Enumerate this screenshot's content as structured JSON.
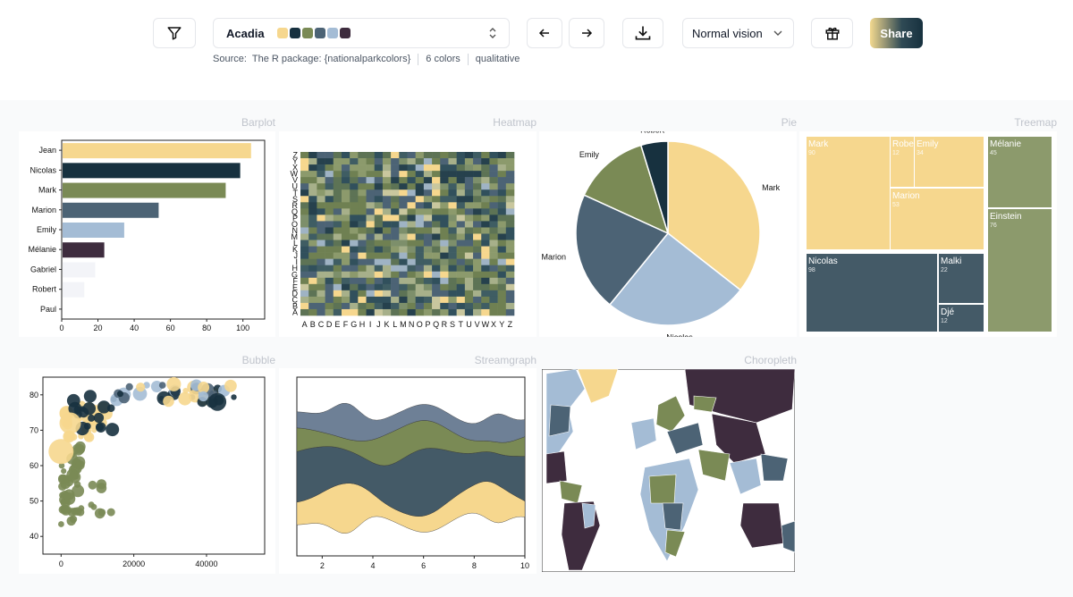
{
  "toolbar": {
    "palette_name": "Acadia",
    "colors": [
      "#f6d78e",
      "#17313f",
      "#7a8a55",
      "#4c6375",
      "#a4bcd5",
      "#3e2c3e"
    ],
    "source_label": "Source:",
    "source_value": "The R package: {nationalparkcolors}",
    "color_count": "6 colors",
    "palette_type": "qualitative",
    "vision_mode": "Normal vision",
    "share_label": "Share"
  },
  "panels": {
    "barplot": "Barplot",
    "heatmap": "Heatmap",
    "pie": "Pie",
    "treemap": "Treemap",
    "bubble": "Bubble",
    "streamgraph": "Streamgraph",
    "choropleth": "Choropleth"
  },
  "chart_data": [
    {
      "type": "bar",
      "title": "Barplot",
      "categories": [
        "Jean",
        "Nicolas",
        "Mark",
        "Marion",
        "Emily",
        "Mélanie",
        "Gabriel",
        "Robert",
        "Paul"
      ],
      "values": [
        104,
        98,
        90,
        53,
        34,
        23,
        18,
        12,
        0
      ],
      "colors": [
        "#f6d78e",
        "#17313f",
        "#7a8a55",
        "#4c6375",
        "#a4bcd5",
        "#3e2c3e",
        "#f3f4f8",
        "#f3f4f8",
        "#f3f4f8"
      ],
      "xticks": [
        0,
        20,
        40,
        60,
        80,
        100
      ],
      "xlim": [
        0,
        112
      ]
    },
    {
      "type": "heatmap",
      "title": "Heatmap",
      "xlabels": [
        "A",
        "B",
        "C",
        "D",
        "E",
        "F",
        "G",
        "H",
        "I",
        "J",
        "K",
        "L",
        "M",
        "N",
        "O",
        "P",
        "Q",
        "R",
        "S",
        "T",
        "U",
        "V",
        "W",
        "X",
        "Y",
        "Z"
      ],
      "ylabels": [
        "Z",
        "Y",
        "X",
        "W",
        "V",
        "U",
        "T",
        "S",
        "R",
        "Q",
        "P",
        "O",
        "N",
        "M",
        "L",
        "K",
        "J",
        "I",
        "H",
        "G",
        "F",
        "E",
        "D",
        "C",
        "B",
        "A"
      ]
    },
    {
      "type": "pie",
      "title": "Pie",
      "slices": [
        {
          "label": "Mark",
          "value": 90,
          "color": "#f6d78e"
        },
        {
          "label": "Nicolas",
          "value": 64,
          "color": "#a4bcd5"
        },
        {
          "label": "Marion",
          "value": 53,
          "color": "#4c6375"
        },
        {
          "label": "Emily",
          "value": 34,
          "color": "#7a8a55"
        },
        {
          "label": "Robert",
          "value": 12,
          "color": "#17313f"
        }
      ]
    },
    {
      "type": "treemap",
      "title": "Treemap",
      "items": [
        {
          "label": "Mark",
          "value": "90",
          "color": "#f6d78e"
        },
        {
          "label": "Robe",
          "value": "12",
          "color": "#f6d78e"
        },
        {
          "label": "Emily",
          "value": "34",
          "color": "#f6d78e"
        },
        {
          "label": "Marion",
          "value": "53",
          "color": "#f6d78e"
        },
        {
          "label": "Nicolas",
          "value": "98",
          "color": "#445a67"
        },
        {
          "label": "Malki",
          "value": "22",
          "color": "#445a67"
        },
        {
          "label": "Djé",
          "value": "12",
          "color": "#445a67"
        },
        {
          "label": "Mélanie",
          "value": "45",
          "color": "#8c9a6c"
        },
        {
          "label": "Einstein",
          "value": "76",
          "color": "#8c9a6c"
        }
      ]
    },
    {
      "type": "scatter",
      "title": "Bubble",
      "xticks": [
        0,
        20000,
        40000
      ],
      "yticks": [
        40,
        50,
        60,
        70,
        80
      ],
      "xlim": [
        -5000,
        56000
      ],
      "ylim": [
        35,
        85
      ]
    },
    {
      "type": "area",
      "title": "Streamgraph",
      "xticks": [
        2,
        4,
        6,
        8,
        10
      ],
      "xlim": [
        1,
        10
      ]
    },
    {
      "type": "map",
      "title": "Choropleth"
    }
  ]
}
